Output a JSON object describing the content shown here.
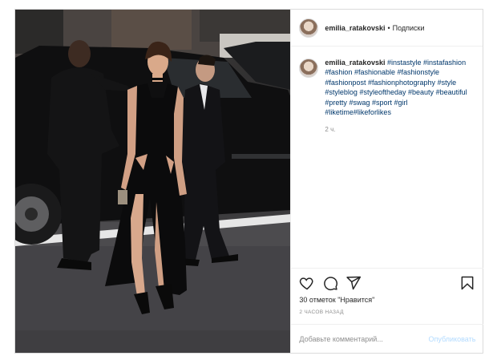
{
  "post": {
    "photo_alt": "",
    "header": {
      "username": "emilia_ratakovski",
      "separator": "•",
      "follow_label": "Подписки"
    },
    "caption": {
      "username": "emilia_ratakovski",
      "hashtags": [
        "#instastyle",
        "#instafashion",
        "#fashion",
        "#fashionable",
        "#fashionstyle",
        "#fashionpost",
        "#fashionphotography",
        "#style",
        "#styleblog",
        "#styleoftheday",
        "#beauty",
        "#beautiful",
        "#pretty",
        "#swag",
        "#sport",
        "#girl",
        "#liketime",
        "#likeforlikes"
      ],
      "time_ago": "2 ч."
    },
    "actions": {
      "icons": [
        "heart-icon",
        "comment-icon",
        "share-icon",
        "bookmark-icon"
      ],
      "likes_text": "30 отметок \"Нравится\"",
      "posted_text": "2 ЧАСОВ НАЗАД"
    },
    "comment": {
      "placeholder": "Добавьте комментарий...",
      "publish_label": "Опубликовать"
    }
  }
}
